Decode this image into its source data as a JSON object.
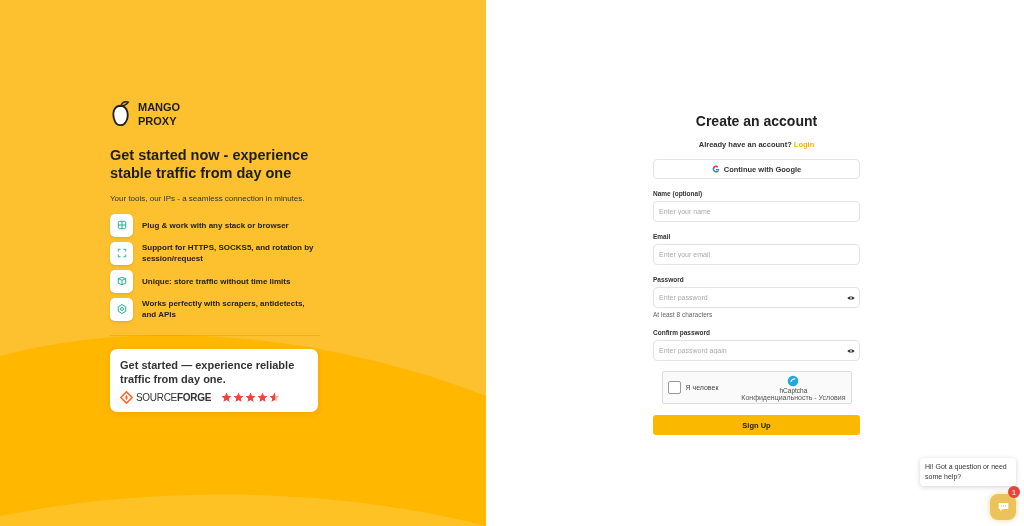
{
  "brand": {
    "line1": "MANGO",
    "line2": "PROXY"
  },
  "headline": "Get started now - experience stable traffic from day one",
  "subtitle": "Your tools, our IPs - a seamless connection in minutes.",
  "features": [
    {
      "kind": "grid",
      "text": "Plug & work with any stack or browser"
    },
    {
      "kind": "rotate",
      "text": "Support for HTTPS, SOCKS5, and rotation by session/request"
    },
    {
      "kind": "box",
      "text": "Unique: store traffic without time limits"
    },
    {
      "kind": "gear",
      "text": "Works perfectly with scrapers, antidetects, and APIs"
    }
  ],
  "review": {
    "text": "Get started — experience reliable traffic from day one.",
    "source_light": "SOURCE",
    "source_bold": "FORGE",
    "stars": 4.5
  },
  "form": {
    "title": "Create an account",
    "have_account": "Already have an account?",
    "login_link": "Login",
    "google_button": "Continue with Google",
    "fields": [
      {
        "label": "Name (optional)",
        "placeholder": "Enter your name",
        "kind": "text"
      },
      {
        "label": "Email",
        "placeholder": "Enter your email",
        "kind": "text"
      },
      {
        "label": "Password",
        "placeholder": "Enter password",
        "kind": "password",
        "hint": "At least 8 characters"
      },
      {
        "label": "Confirm password",
        "placeholder": "Enter password again",
        "kind": "password"
      }
    ],
    "captcha": {
      "label": "Я человек",
      "checked": false,
      "brand": "hCaptcha",
      "links": "Конфиденциальность - Условия"
    },
    "submit": "Sign Up"
  },
  "chat": {
    "message": "Hi! Got a question or need some help?",
    "badge": "1"
  }
}
